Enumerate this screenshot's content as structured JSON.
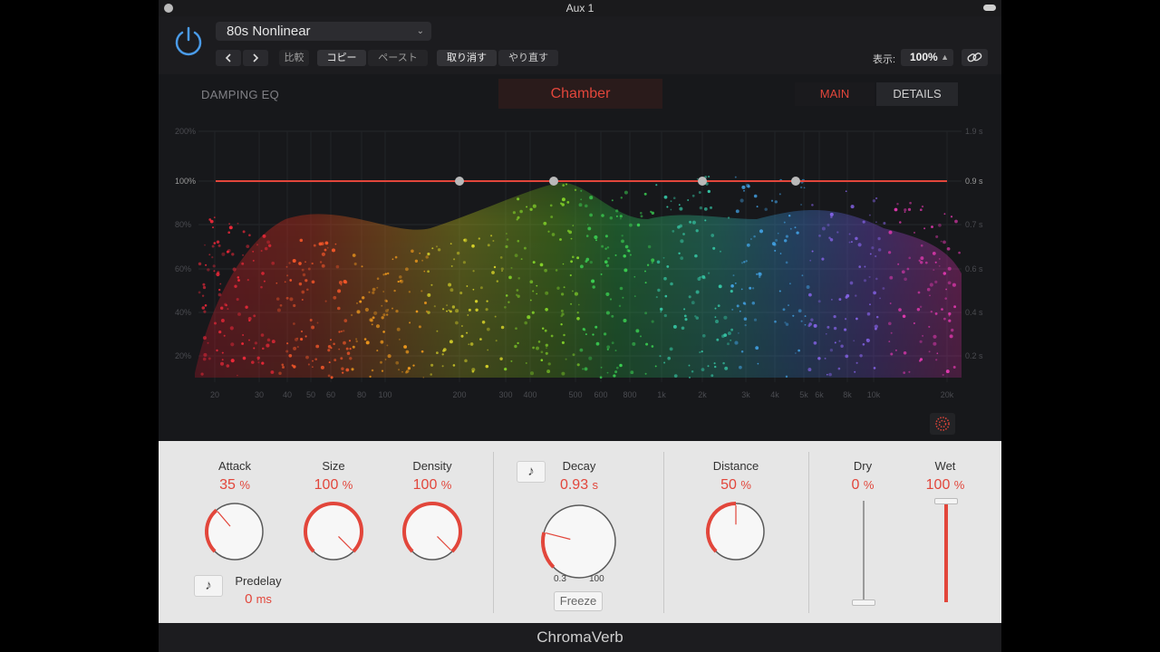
{
  "window": {
    "title": "Aux 1"
  },
  "toolbar": {
    "preset": "80s Nonlinear",
    "prev_icon": "chevron-left-icon",
    "next_icon": "chevron-right-icon",
    "compare": "比較",
    "copy": "コピー",
    "paste": "ペースト",
    "undo": "取り消す",
    "redo": "やり直す",
    "view_label": "表示:",
    "zoom": "100%"
  },
  "viz": {
    "damping_eq": "DAMPING EQ",
    "room_type": "Chamber",
    "tabs": [
      {
        "label": "MAIN",
        "active": true
      },
      {
        "label": "DETAILS",
        "active": false
      }
    ],
    "left_axis": [
      "200%",
      "100%",
      "80%",
      "60%",
      "40%",
      "20%"
    ],
    "right_axis": [
      "1.9 s",
      "0.9 s",
      "0.7 s",
      "0.6 s",
      "0.4 s",
      "0.2 s"
    ],
    "freq_axis": [
      "20",
      "30",
      "40",
      "50",
      "60",
      "80",
      "100",
      "200",
      "300",
      "400",
      "500",
      "600",
      "800",
      "1k",
      "2k",
      "3k",
      "4k",
      "5k",
      "6k",
      "8k",
      "10k",
      "20k"
    ],
    "eq_line_level": "100%"
  },
  "params": {
    "attack": {
      "label": "Attack",
      "value": "35",
      "unit": "%",
      "fraction": 0.35
    },
    "size": {
      "label": "Size",
      "value": "100",
      "unit": "%",
      "fraction": 1.0
    },
    "density": {
      "label": "Density",
      "value": "100",
      "unit": "%",
      "fraction": 1.0
    },
    "predelay": {
      "label": "Predelay",
      "value": "0",
      "unit": "ms"
    },
    "decay": {
      "label": "Decay",
      "value": "0.93",
      "unit": "s",
      "range_min": "0.3",
      "range_max": "100",
      "fraction": 0.22
    },
    "freeze": "Freeze",
    "distance": {
      "label": "Distance",
      "value": "50",
      "unit": "%",
      "fraction": 0.5
    },
    "dry": {
      "label": "Dry",
      "value": "0",
      "unit": "%",
      "fraction": 0.0
    },
    "wet": {
      "label": "Wet",
      "value": "100",
      "unit": "%",
      "fraction": 1.0
    }
  },
  "footer": {
    "brand": "ChromaVerb"
  },
  "colors": {
    "accent": "#e2463b",
    "power": "#4a9be8"
  }
}
